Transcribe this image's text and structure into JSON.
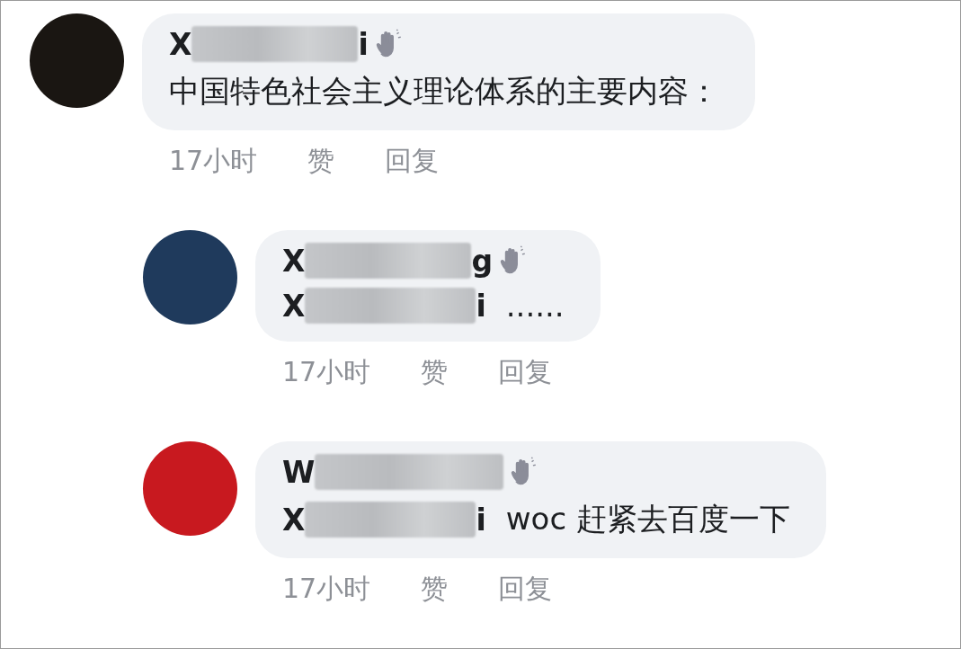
{
  "comments": [
    {
      "color": "#1a1612",
      "name_start": "X",
      "name_end": "i",
      "text": "中国特色社会主义理论体系的主要内容：",
      "time": "17小时",
      "like": "赞",
      "reply": "回复",
      "replies": [
        {
          "color": "#1f3a5c",
          "name_start": "X",
          "name_end": "g",
          "mention": {
            "start": "X",
            "end": "i"
          },
          "text": "......",
          "time": "17小时",
          "like": "赞",
          "reply": "回复"
        },
        {
          "color": "#c8191f",
          "name_start": "W",
          "mention": {
            "start": "X",
            "end": "i"
          },
          "text": "woc 赶紧去百度一下",
          "time": "17小时",
          "like": "赞",
          "reply": "回复"
        }
      ]
    }
  ]
}
